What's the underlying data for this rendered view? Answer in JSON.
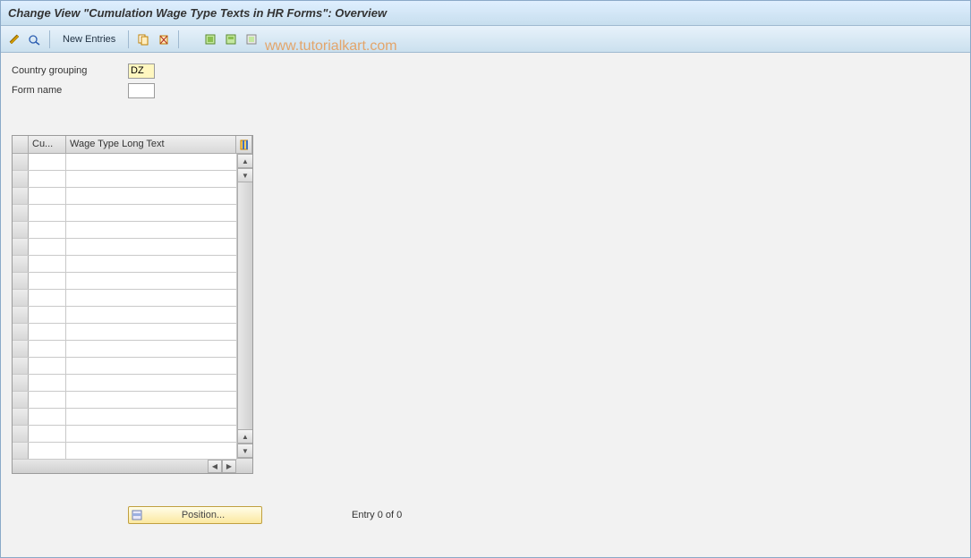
{
  "title": "Change View \"Cumulation Wage Type Texts in HR Forms\": Overview",
  "toolbar": {
    "new_entries_label": "New Entries"
  },
  "form": {
    "country_grouping_label": "Country grouping",
    "country_grouping_value": "DZ",
    "form_name_label": "Form name",
    "form_name_value": ""
  },
  "table": {
    "columns": {
      "cu": "Cu...",
      "wage_text": "Wage Type Long Text"
    },
    "row_count": 18
  },
  "footer": {
    "position_label": "Position...",
    "entry_text": "Entry 0 of 0"
  },
  "watermark": "www.tutorialkart.com"
}
